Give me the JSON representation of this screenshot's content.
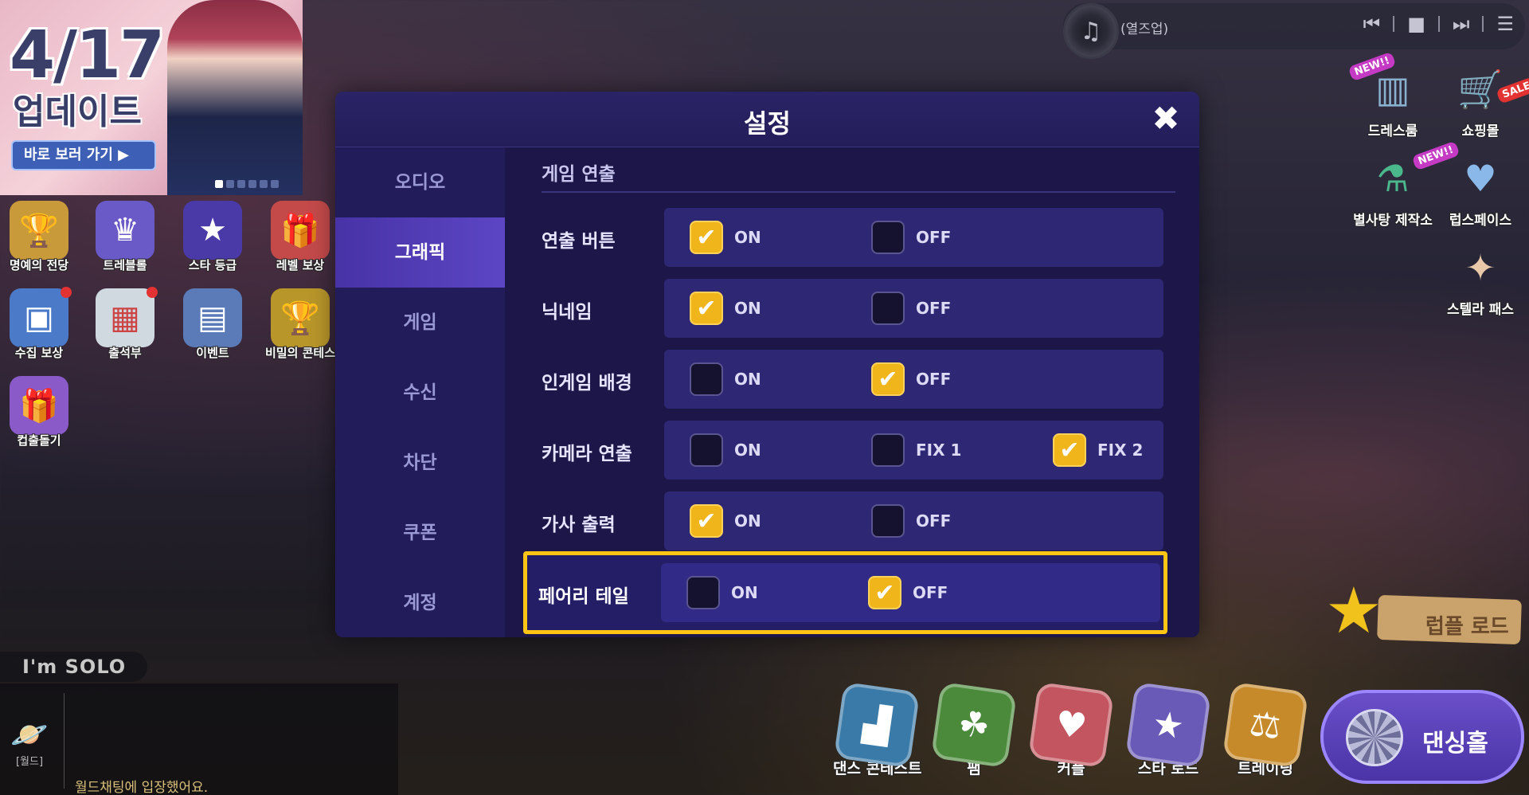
{
  "banner": {
    "date": "4/17",
    "subtitle": "업데이트",
    "button_label": "바로 보러 가기 ▶"
  },
  "left_icons": [
    {
      "label": "명예의 전당",
      "icon": "trophy-icon"
    },
    {
      "label": "트레블롤",
      "icon": "crown-icon"
    },
    {
      "label": "스타 등급",
      "icon": "star-icon"
    },
    {
      "label": "레벨 보상",
      "icon": "gift-icon"
    },
    {
      "label": "수집 보상",
      "icon": "collection-icon"
    },
    {
      "label": "출석부",
      "icon": "calendar-icon"
    },
    {
      "label": "이벤트",
      "icon": "clipboard-icon"
    },
    {
      "label": "비밀의 콘테스",
      "icon": "cup-icon"
    },
    {
      "label": "컵출돌기",
      "icon": "present-icon"
    }
  ],
  "music": {
    "title": "(열즈업)",
    "prev": "⏮",
    "stop": "■",
    "next": "⏭",
    "playlist": "☰"
  },
  "right_icons": [
    {
      "label": "드레스룸",
      "badge": "NEW!!",
      "icon": "dressroom-icon"
    },
    {
      "label": "쇼핑몰",
      "badge": "SALE",
      "icon": "shop-icon"
    },
    {
      "label": "별사탕 제작소",
      "badge": "NEW!!",
      "icon": "factory-icon"
    },
    {
      "label": "럽스페이스",
      "badge": "",
      "icon": "wings-icon"
    },
    {
      "label": "스텔라 패스",
      "badge": "",
      "icon": "pass-icon"
    }
  ],
  "chat": {
    "tag": "I'm SOLO",
    "world_label": "[월드]",
    "message": "월드채팅에 입장했어요."
  },
  "bottom_buttons": [
    {
      "label": "댄스 콘테스트",
      "color": "#3a7aa8",
      "icon": "podium-icon"
    },
    {
      "label": "팸",
      "color": "#4a8a3a",
      "icon": "family-icon"
    },
    {
      "label": "커플",
      "color": "#c2555f",
      "icon": "couple-icon"
    },
    {
      "label": "스타 로드",
      "color": "#6a5ab8",
      "icon": "star-road-icon"
    },
    {
      "label": "트레이닝",
      "color": "#c78a2a",
      "icon": "dumbbell-icon"
    }
  ],
  "lupp_road": {
    "label": "럽플 로드"
  },
  "dance_hall": {
    "label": "댄싱홀"
  },
  "settings": {
    "title": "설정",
    "close": "✖",
    "tabs": [
      {
        "label": "오디오",
        "active": false
      },
      {
        "label": "그래픽",
        "active": true
      },
      {
        "label": "게임",
        "active": false
      },
      {
        "label": "수신",
        "active": false
      },
      {
        "label": "차단",
        "active": false
      },
      {
        "label": "쿠폰",
        "active": false
      },
      {
        "label": "계정",
        "active": false
      }
    ],
    "section_title": "게임 연출",
    "rows": [
      {
        "label": "연출 버튼",
        "options": [
          {
            "label": "ON",
            "checked": true
          },
          {
            "label": "OFF",
            "checked": false
          }
        ]
      },
      {
        "label": "닉네임",
        "options": [
          {
            "label": "ON",
            "checked": true
          },
          {
            "label": "OFF",
            "checked": false
          }
        ]
      },
      {
        "label": "인게임 배경",
        "options": [
          {
            "label": "ON",
            "checked": false
          },
          {
            "label": "OFF",
            "checked": true
          }
        ]
      },
      {
        "label": "카메라 연출",
        "options": [
          {
            "label": "ON",
            "checked": false
          },
          {
            "label": "FIX 1",
            "checked": false
          },
          {
            "label": "FIX 2",
            "checked": true
          }
        ]
      },
      {
        "label": "가사 출력",
        "options": [
          {
            "label": "ON",
            "checked": true
          },
          {
            "label": "OFF",
            "checked": false
          }
        ]
      },
      {
        "label": "페어리 테일",
        "options": [
          {
            "label": "ON",
            "checked": false
          },
          {
            "label": "OFF",
            "checked": true
          }
        ]
      }
    ],
    "highlight_color": "#ffc515",
    "accent_color": "#f0b51a"
  }
}
